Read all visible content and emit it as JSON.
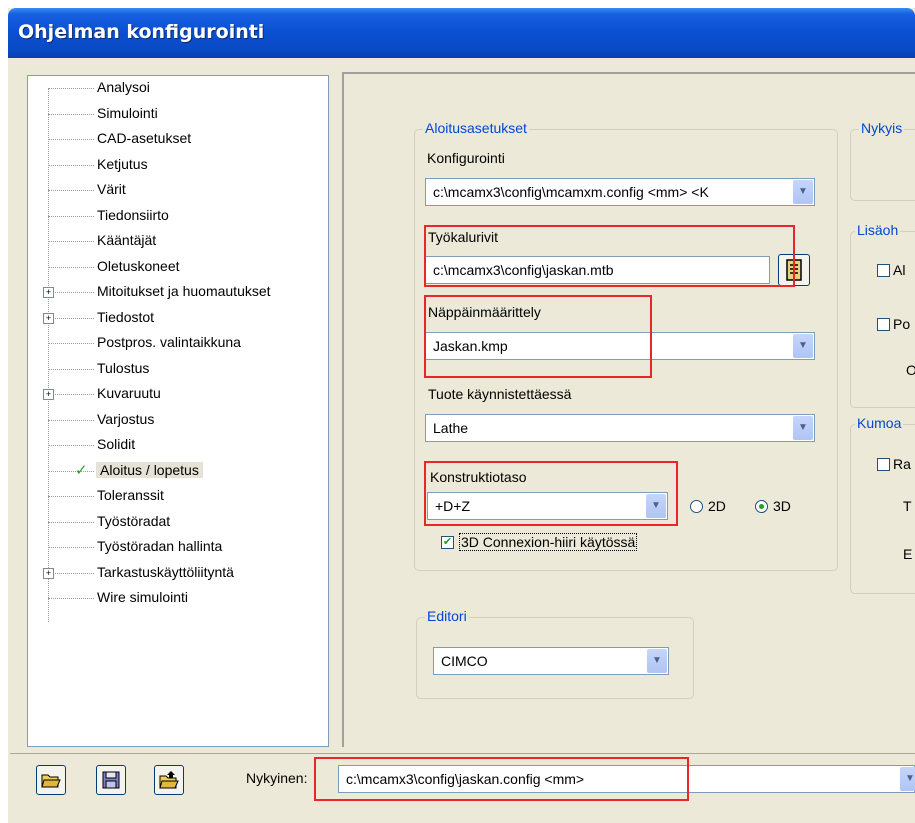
{
  "window": {
    "title": "Ohjelman konfigurointi"
  },
  "tree": {
    "items": [
      {
        "label": "Analysoi"
      },
      {
        "label": "Simulointi"
      },
      {
        "label": "CAD-asetukset"
      },
      {
        "label": "Ketjutus"
      },
      {
        "label": "Värit"
      },
      {
        "label": "Tiedonsiirto"
      },
      {
        "label": "Kääntäjät"
      },
      {
        "label": "Oletuskoneet"
      },
      {
        "label": "Mitoitukset ja huomautukset"
      },
      {
        "label": "Tiedostot"
      },
      {
        "label": "Postpros. valintaikkuna"
      },
      {
        "label": "Tulostus"
      },
      {
        "label": "Kuvaruutu"
      },
      {
        "label": "Varjostus"
      },
      {
        "label": "Solidit"
      },
      {
        "label": "Aloitus / lopetus"
      },
      {
        "label": "Toleranssit"
      },
      {
        "label": "Työstöradat"
      },
      {
        "label": "Työstöradan hallinta"
      },
      {
        "label": "Tarkastuskäyttöliityntä"
      },
      {
        "label": "Wire simulointi"
      }
    ],
    "expander_symbol": "+",
    "check_symbol": "✓"
  },
  "startup": {
    "group_label": "Aloitusasetukset",
    "config_label": "Konfigurointi",
    "config_value": "c:\\mcamx3\\config\\mcamxm.config <mm> <K",
    "toolbars_label": "Työkalurivit",
    "toolbars_value": "c:\\mcamx3\\config\\jaskan.mtb",
    "keymap_label": "Näppäinmäärittely",
    "keymap_value": "Jaskan.kmp",
    "product_label": "Tuote käynnistettäessä",
    "product_value": "Lathe",
    "cplane_label": "Konstruktiotaso",
    "cplane_value": "+D+Z",
    "radio_2d": "2D",
    "radio_3d": "3D",
    "connexion_label": "3D Connexion-hiiri käytössä"
  },
  "editor": {
    "group_label": "Editori",
    "value": "CIMCO"
  },
  "right_groups": {
    "current_label": "Nykyis",
    "extra_label": "Lisäoh",
    "extra_opt1": "Al",
    "extra_opt2": "Po",
    "extra_text": "O",
    "override_label": "Kumoa",
    "override_opt1": "Ra",
    "override_t": "T",
    "override_e": "E"
  },
  "footer": {
    "current_label": "Nykyinen:",
    "current_value": "c:\\mcamx3\\config\\jaskan.config <mm>"
  },
  "icons": {
    "open": "open-folder-icon",
    "save": "save-disk-icon",
    "merge": "merge-folder-icon",
    "file_picker": "file-picker-icon",
    "dropdown": "chevron-down-icon"
  },
  "colors": {
    "title_bar": "#0a4fd1",
    "highlight": "#e8272b",
    "group_label": "#0046d5"
  }
}
